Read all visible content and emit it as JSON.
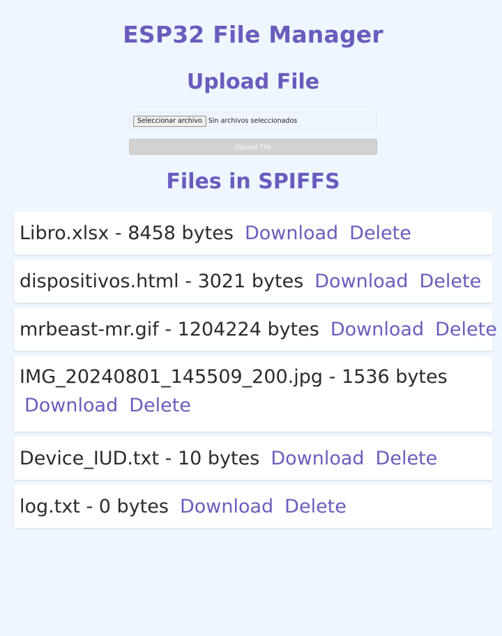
{
  "page": {
    "title": "ESP32 File Manager",
    "upload_heading": "Upload File",
    "files_heading": "Files in SPIFFS"
  },
  "upload": {
    "choose_label": "Seleccionar archivo",
    "no_file_text": "Sin archivos seleccionados",
    "submit_label": "Upload File"
  },
  "files": [
    {
      "text": "Libro.xlsx - 8458 bytes",
      "download": "Download",
      "delete": "Delete"
    },
    {
      "text": "dispositivos.html - 3021 bytes",
      "download": "Download",
      "delete": "Delete"
    },
    {
      "text": "mrbeast-mr.gif - 1204224 bytes",
      "download": "Download",
      "delete": "Delete"
    },
    {
      "text": "IMG_20240801_145509_200.jpg - 1536 bytes",
      "download": "Download",
      "delete": "Delete"
    },
    {
      "text": "Device_IUD.txt - 10 bytes",
      "download": "Download",
      "delete": "Delete"
    },
    {
      "text": "log.txt - 0 bytes",
      "download": "Download",
      "delete": "Delete"
    }
  ],
  "colors": {
    "background": "#eef6ff",
    "accent": "#6a5cbd",
    "text": "#2b2b2b",
    "card": "#ffffff",
    "disabled_button": "#d2d2d2"
  }
}
